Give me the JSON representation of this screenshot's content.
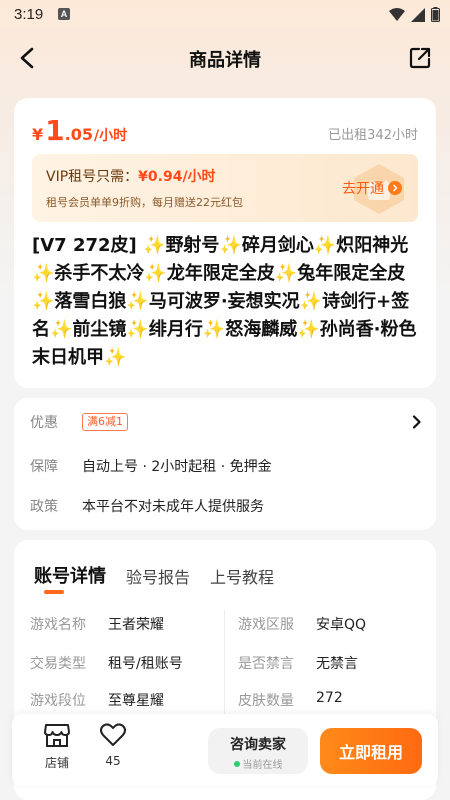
{
  "status_bar": {
    "time": "3:19",
    "notif": "A"
  },
  "header": {
    "title": "商品详情"
  },
  "price": {
    "symbol": "¥",
    "integer": "1",
    "decimal": ".05",
    "unit": "/小时",
    "rented": "已出租342小时"
  },
  "vip": {
    "label": "VIP租号只需：",
    "price": "¥0.94/小时",
    "desc": "租号会员单单9折购，每月赠送22元红包",
    "open": "去开通"
  },
  "product_title": "[V7 272皮] ✨野射号✨碎月剑心✨炽阳神光✨杀手不太冷✨龙年限定全皮✨兔年限定全皮✨落雪白狼✨马可波罗·妄想实况✨诗剑行+签名✨前尘镜✨绯月行✨怒海麟威✨孙尚香·粉色末日机甲✨",
  "info": {
    "promo_label": "优惠",
    "promo_tag": "满6减1",
    "guarantee_label": "保障",
    "guarantee_value": "自动上号 · 2小时起租 · 免押金",
    "policy_label": "政策",
    "policy_value": "本平台不对未成年人提供服务"
  },
  "tabs": [
    "账号详情",
    "验号报告",
    "上号教程"
  ],
  "details": {
    "game_name_label": "游戏名称",
    "game_name": "王者荣耀",
    "region_label": "游戏区服",
    "region": "安卓QQ",
    "trade_type_label": "交易类型",
    "trade_type": "租号/租账号",
    "ban_label": "是否禁言",
    "ban": "无禁言",
    "rank_label": "游戏段位",
    "rank": "至尊星耀",
    "skins_label": "皮肤数量",
    "skins": "272"
  },
  "bottom": {
    "shop": "店铺",
    "fav_count": "45",
    "consult": "咨询卖家",
    "consult_status": "当前在线",
    "rent": "立即租用"
  },
  "colors": {
    "accent": "#ff6a1a",
    "price": "#ff4a1a",
    "online": "#2ecc71"
  }
}
